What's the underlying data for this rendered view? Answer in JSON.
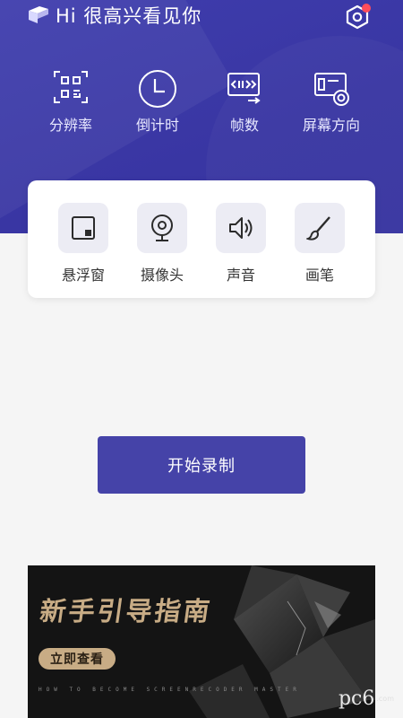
{
  "header": {
    "greeting": "Hi 很高兴看见你"
  },
  "quick_settings": [
    {
      "label": "分辨率",
      "icon": "qr-resolution-icon"
    },
    {
      "label": "倒计时",
      "icon": "clock-icon"
    },
    {
      "label": "帧数",
      "icon": "frames-icon"
    },
    {
      "label": "屏幕方向",
      "icon": "screen-orientation-icon"
    }
  ],
  "tools": [
    {
      "label": "悬浮窗",
      "icon": "floating-window-icon"
    },
    {
      "label": "摄像头",
      "icon": "camera-icon"
    },
    {
      "label": "声音",
      "icon": "speaker-icon"
    },
    {
      "label": "画笔",
      "icon": "brush-icon"
    }
  ],
  "main": {
    "start_label": "开始录制"
  },
  "banner": {
    "title": "新手引导指南",
    "cta": "立即查看",
    "subtitle": "HOW TO BECOME SCREENRECODER MASTER"
  },
  "watermark": {
    "text": "pc6",
    "small": ".com"
  },
  "colors": {
    "hero": "#3f3dad",
    "accent": "#4543a8",
    "notification": "#ff4d5a",
    "banner_gold": "#c8ac85"
  }
}
